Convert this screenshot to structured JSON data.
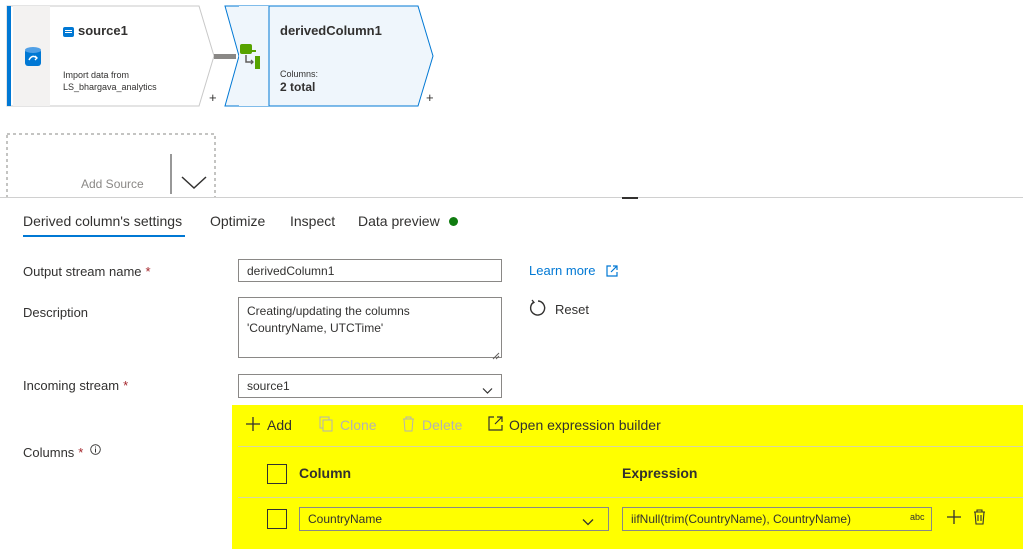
{
  "canvas": {
    "source_node": {
      "title": "source1",
      "description_line1": "Import data from",
      "description_line2": "LS_bhargava_analytics",
      "add_label": "+"
    },
    "derived_node": {
      "title": "derivedColumn1",
      "columns_label": "Columns:",
      "columns_value": "2 total",
      "add_label": "+"
    },
    "add_source_label": "Add Source"
  },
  "tabs": [
    {
      "label": "Derived column's settings",
      "active": true
    },
    {
      "label": "Optimize",
      "active": false
    },
    {
      "label": "Inspect",
      "active": false
    },
    {
      "label": "Data preview",
      "active": false
    }
  ],
  "form": {
    "output_stream_label": "Output stream name",
    "output_stream_value": "derivedColumn1",
    "required_marker": "*",
    "learn_more": "Learn more",
    "description_label": "Description",
    "description_value": "Creating/updating the columns\n'CountryName, UTCTime'",
    "reset_label": "Reset",
    "incoming_stream_label": "Incoming stream",
    "incoming_stream_value": "source1",
    "columns_label": "Columns"
  },
  "columns_grid": {
    "toolbar": {
      "add": "Add",
      "clone": "Clone",
      "delete": "Delete",
      "open_builder": "Open expression builder"
    },
    "headers": {
      "column": "Column",
      "expression": "Expression"
    },
    "rows": [
      {
        "column": "CountryName",
        "expression": "iifNull(trim(CountryName), CountryName)",
        "type_badge": "abc"
      }
    ]
  },
  "colors": {
    "accent": "#0078d4",
    "highlight": "#ffff00",
    "status_green": "#107c10",
    "required": "#a4262c"
  }
}
